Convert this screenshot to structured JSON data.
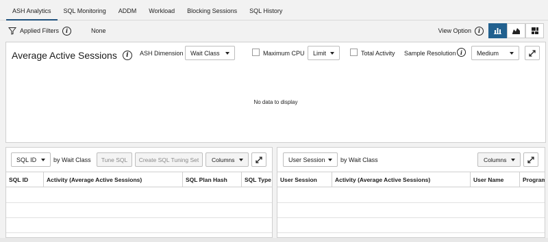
{
  "tabs": [
    {
      "label": "ASH Analytics",
      "active": true
    },
    {
      "label": "SQL Monitoring"
    },
    {
      "label": "ADDM"
    },
    {
      "label": "Workload"
    },
    {
      "label": "Blocking Sessions"
    },
    {
      "label": "SQL History"
    }
  ],
  "filters": {
    "label": "Applied Filters",
    "value": "None"
  },
  "view_option": {
    "label": "View Option"
  },
  "ash": {
    "title": "Average Active Sessions",
    "dimension_label": "ASH Dimension",
    "dimension_value": "Wait Class",
    "max_cpu_label": "Maximum CPU",
    "limit_value": "Limit",
    "total_activity_label": "Total Activity",
    "resolution_label": "Sample Resolution",
    "resolution_value": "Medium",
    "no_data": "No data to display"
  },
  "left_table": {
    "group_select": "SQL ID",
    "by_label": "by Wait Class",
    "tune_sql": "Tune SQL",
    "create_set": "Create SQL Tuning Set",
    "columns": "Columns",
    "headers": [
      "SQL ID",
      "Activity (Average Active Sessions)",
      "SQL Plan Hash",
      "SQL Type"
    ]
  },
  "right_table": {
    "group_select": "User Session",
    "by_label": "by Wait Class",
    "columns": "Columns",
    "headers": [
      "User Session",
      "Activity (Average Active Sessions)",
      "User Name",
      "Program"
    ]
  },
  "colors": {
    "accent": "#22618f",
    "tab_underline": "#1d4f7c"
  }
}
